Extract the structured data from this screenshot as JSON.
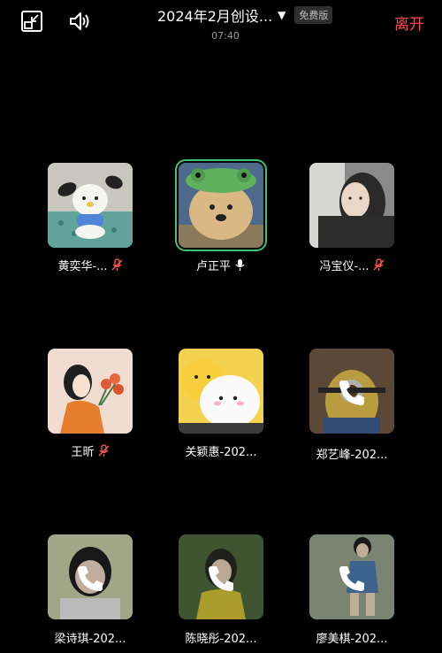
{
  "header": {
    "title": "2024年2月创设...",
    "caret": "▼",
    "badge": "免费版",
    "duration": "07:40",
    "leave_label": "离开"
  },
  "colors": {
    "background": "#000000",
    "accent_leave": "#ff4a4a",
    "speaking_border": "#3ec276"
  },
  "participants": [
    {
      "name": "黄奕华-...",
      "mic": "muted",
      "status": "video"
    },
    {
      "name": "卢正平",
      "mic": "on",
      "status": "video",
      "speaking": true
    },
    {
      "name": "冯宝仪-...",
      "mic": "muted",
      "status": "video"
    },
    {
      "name": "王昕",
      "mic": "muted",
      "status": "video"
    },
    {
      "name": "关颖惠-202...",
      "mic": "none",
      "status": "video"
    },
    {
      "name": "郑艺峰-202...",
      "mic": "none",
      "status": "calling"
    },
    {
      "name": "梁诗琪-202...",
      "mic": "none",
      "status": "calling"
    },
    {
      "name": "陈晓彤-202...",
      "mic": "none",
      "status": "calling"
    },
    {
      "name": "廖美棋-202...",
      "mic": "none",
      "status": "calling"
    }
  ]
}
